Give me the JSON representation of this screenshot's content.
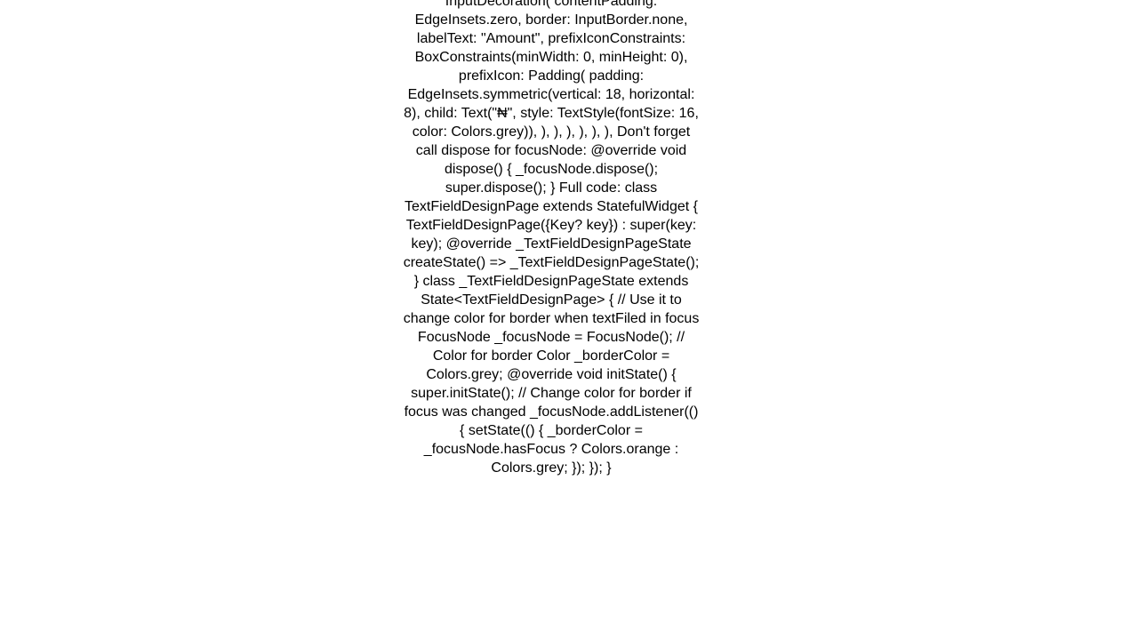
{
  "body": {
    "text": "TextInputType.number,       decoration: InputDecoration(         contentPadding: EdgeInsets.zero,         border: InputBorder.none,         labelText: \"Amount\",         prefixIconConstraints: BoxConstraints(minWidth: 0, minHeight: 0),         prefixIcon: Padding(           padding: EdgeInsets.symmetric(vertical: 18, horizontal: 8),           child: Text(\"₦\", style: TextStyle(fontSize: 16, color: Colors.grey)),         ),       ),     ),   ),   ), ),   Don't forget call dispose for focusNode:  @override void dispose() {   _focusNode.dispose();   super.dispose(); }  Full code: class TextFieldDesignPage extends StatefulWidget {   TextFieldDesignPage({Key? key}) : super(key: key);    @override   _TextFieldDesignPageState createState() => _TextFieldDesignPageState(); }  class _TextFieldDesignPageState extends State<TextFieldDesignPage> {   // Use it to change color for border when textFiled in focus   FocusNode _focusNode = FocusNode();    // Color for border   Color _borderColor = Colors.grey;    @override   void initState() {     super.initState();     // Change color for border if focus was changed     _focusNode.addListener(() {       setState(() {         _borderColor = _focusNode.hasFocus ? Colors.orange : Colors.grey;       });     });   }"
  }
}
